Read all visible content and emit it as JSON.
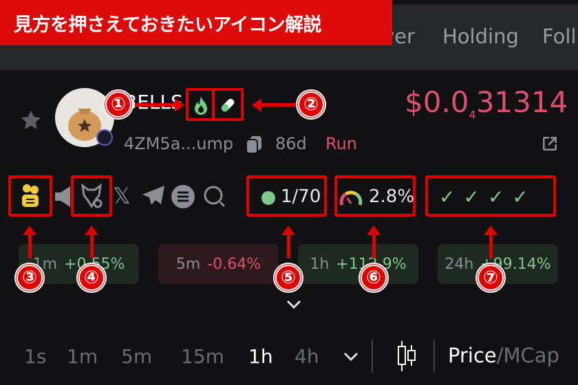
{
  "banner": {
    "title": "見方を押さえておきたいアイコン解説"
  },
  "tabs": [
    "ver",
    "Holding",
    "Foll"
  ],
  "token": {
    "name": "BELLS",
    "address": "4ZM5a...ump",
    "age": "86d",
    "status": "Run",
    "price_main": "$0.0",
    "price_subscript": "4",
    "price_tail": "31314"
  },
  "metrics": {
    "holders": "1/70",
    "gauge": "2.8%"
  },
  "annotations": [
    "①",
    "②",
    "③",
    "④",
    "⑤",
    "⑥",
    "⑦"
  ],
  "stats": [
    {
      "label": "1m",
      "value": "+0.55%",
      "trend": "up"
    },
    {
      "label": "5m",
      "value": "-0.64%",
      "trend": "down"
    },
    {
      "label": "1h",
      "value": "+112.9%",
      "trend": "up"
    },
    {
      "label": "24h",
      "value": "+99.14%",
      "trend": "up"
    }
  ],
  "timeframes": [
    "1s",
    "1m",
    "5m",
    "15m",
    "1h",
    "4h"
  ],
  "active_timeframe": "1h",
  "price_label": "Price",
  "mcap_label": "/MCap",
  "colors": {
    "accent_red": "#e00000",
    "price": "#e0506b",
    "up": "#7cc98a",
    "down": "#e0506b"
  }
}
